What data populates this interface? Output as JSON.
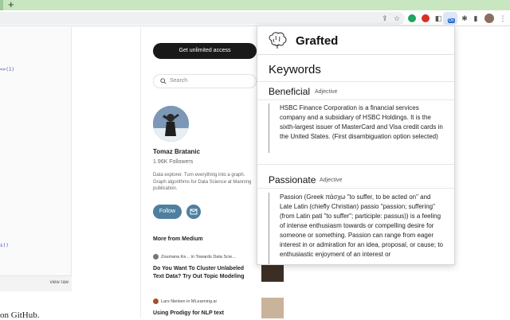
{
  "browser": {
    "new_tab_glyph": "+",
    "extension_badge": "On",
    "icons": [
      "share-icon",
      "star-icon",
      "puzzle-icon",
      "sidebar-icon",
      "kebab-menu-icon"
    ]
  },
  "code": {
    "lines": [
      "=>(1)",
      "s))"
    ],
    "view_raw": "view raw",
    "github_text": "on GitHub."
  },
  "medium": {
    "cta": "Get unlimited access",
    "search_placeholder": "Search",
    "author": {
      "name": "Tomaz Bratanic",
      "followers": "1.96K Followers",
      "bio": "Data explorer. Turn everything into a graph. Graph algorithms for Data Science at Manning publication."
    },
    "follow_label": "Follow",
    "more_heading": "More from Medium",
    "articles": [
      {
        "author": "Zoumana Ke...",
        "in_word": "in",
        "pub": "Towards Data Scie...",
        "title": "Do You Want To Cluster Unlabeled Text Data? Try Out Topic Modeling"
      },
      {
        "author": "Lars Nielsen",
        "in_word": "in",
        "pub": "MLearning.ai",
        "title": "Using Prodigy for NLP text"
      }
    ]
  },
  "grafted": {
    "title": "Grafted",
    "section": "Keywords",
    "keywords": [
      {
        "word": "Beneficial",
        "pos": "Adjective",
        "definition": "HSBC Finance Corporation is a financial services company and a subsidiary of HSBC Holdings. It is the sixth-largest issuer of MasterCard and Visa credit cards in the United States. (First disambiguation option selected)"
      },
      {
        "word": "Passionate",
        "pos": "Adjective",
        "definition": "Passion (Greek πάσχω \"to suffer, to be acted on\" and Late Latin (chiefly Christian) passio \"passion; suffering\" (from Latin pati \"to suffer\"; participle: passus)) is a feeling of intense enthusiasm towards or compelling desire for someone or something. Passion can range from eager interest in or admiration for an idea, proposal, or cause; to enthusiastic enjoyment of an interest or"
      }
    ]
  },
  "colors": {
    "tabstrip": "#c8e6c0",
    "cta_bg": "#191919",
    "follow_bg": "#4e7fa0"
  }
}
